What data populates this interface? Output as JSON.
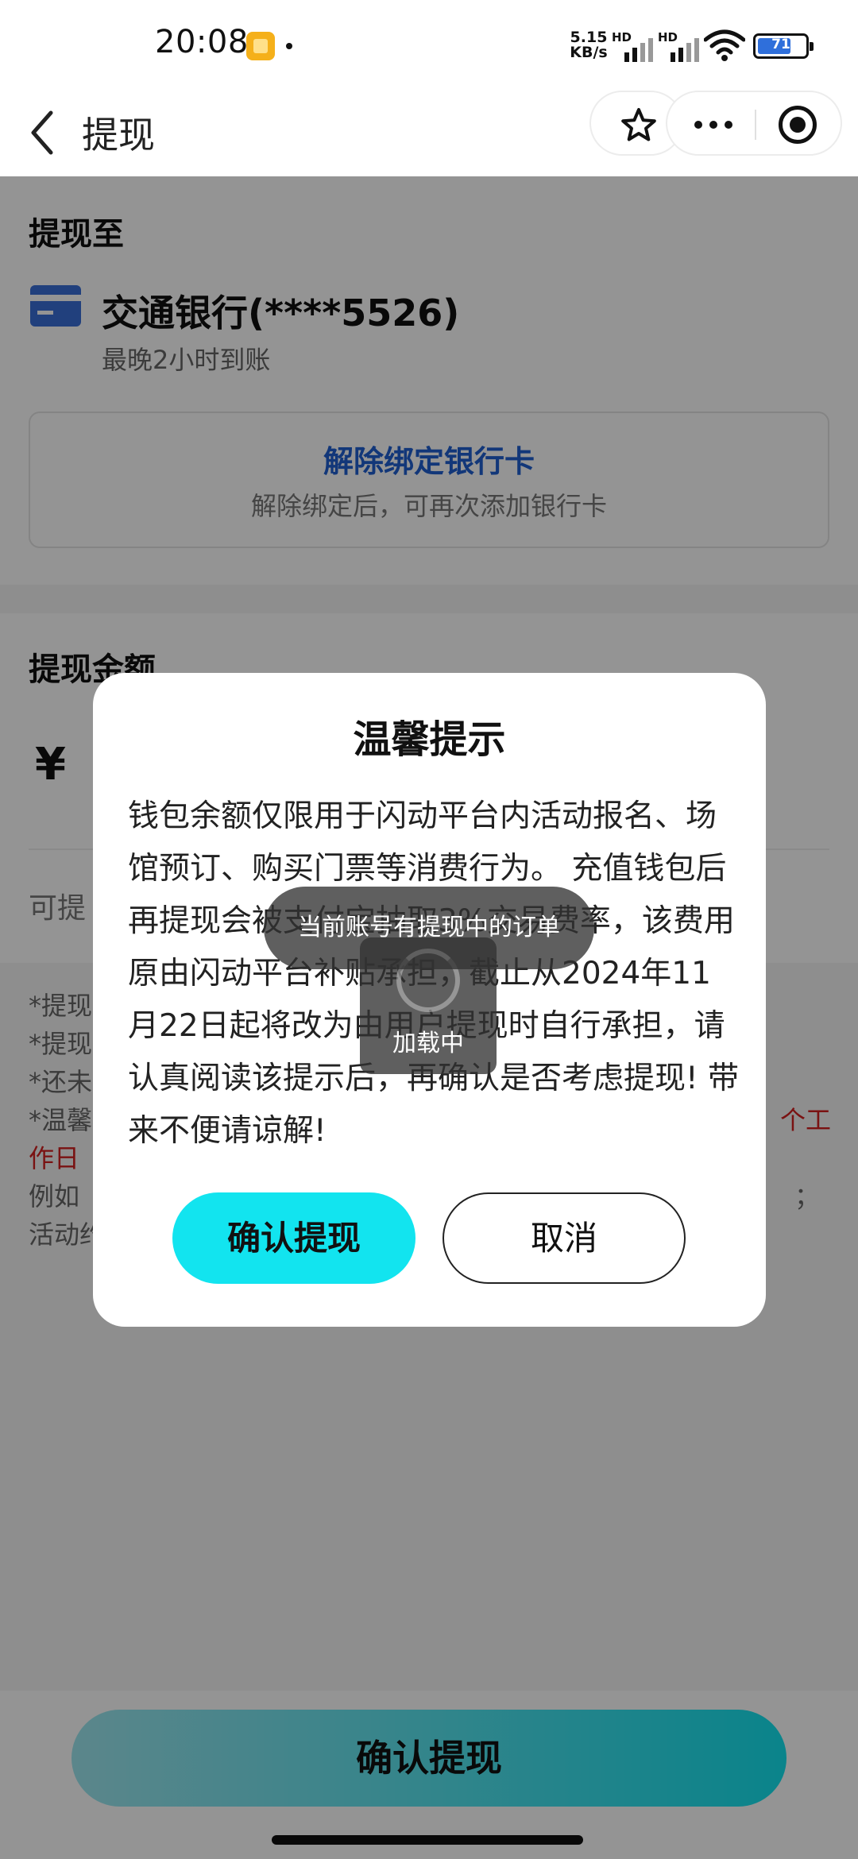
{
  "status_bar": {
    "time": "20:08",
    "net_speed_value": "5.15",
    "net_speed_unit": "KB/s",
    "sim1_label": "HD",
    "sim2_label": "HD",
    "battery_level": "71",
    "battery_fraction": 0.71
  },
  "nav": {
    "title": "提现"
  },
  "withdraw_to": {
    "title": "提现至",
    "bank_name": "交通银行(****5526)",
    "arrival": "最晚2小时到账",
    "unbind_label": "解除绑定银行卡",
    "unbind_hint": "解除绑定后，可再次添加银行卡"
  },
  "amount": {
    "title": "提现金额",
    "currency": "¥",
    "available_label": "可提"
  },
  "notes": {
    "line1": "*提现",
    "line2": "*提现",
    "line3": "*还未",
    "line4_start": "*温馨",
    "line4_red": "个工",
    "line5_red": "作日",
    "line6_start": "例如",
    "line6_end": "；",
    "line7_start": "活动约"
  },
  "bottom": {
    "confirm_label": "确认提现"
  },
  "dialog": {
    "title": "温馨提示",
    "body": "钱包余额仅限用于闪动平台内活动报名、场馆预订、购买门票等消费行为。 充值钱包后再提现会被支付宝抽取3%交易费率，该费用原由闪动平台补贴承担，截止从2024年11月22日起将改为由用户提现时自行承担，请认真阅读该提示后，再确认是否考虑提现! 带来不便请谅解!",
    "confirm_label": "确认提现",
    "cancel_label": "取消"
  },
  "toast": {
    "message": "当前账号有提现中的订单"
  },
  "loading": {
    "label": "加载中"
  },
  "icons": {
    "back": "chevron-left-icon",
    "favorite": "star-icon",
    "more": "more-dots-icon",
    "close_mini": "target-circle-icon",
    "bank": "bank-card-icon"
  },
  "colors": {
    "accent": "#12e4ef",
    "link": "#1f5fd1",
    "warning_red": "#d21f1f",
    "bank_icon": "#3a6fd8"
  }
}
